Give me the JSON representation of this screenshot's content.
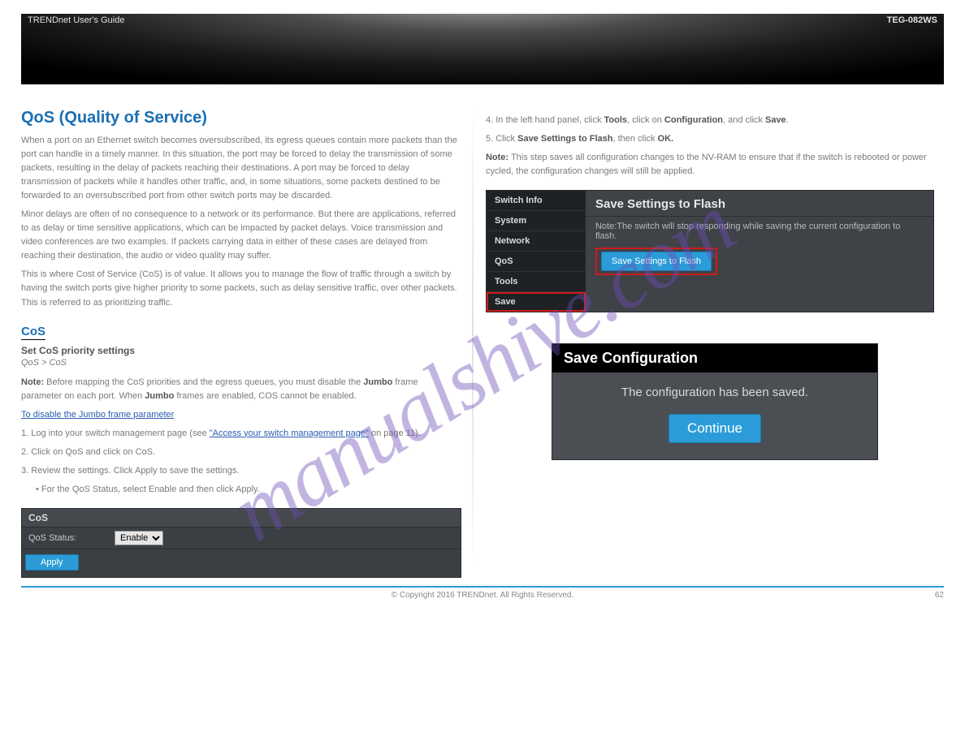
{
  "banner": {
    "left": "TRENDnet User's Guide",
    "right": "TEG-082WS"
  },
  "left": {
    "heading": "QoS (Quality of Service)",
    "intro1": "When a port on an Ethernet switch becomes oversubscribed, its egress queues contain more packets than the port can handle in a timely manner. In this situation, the port may be forced to delay the transmission of some packets, resulting in the delay of packets reaching their destinations. A port may be forced to delay transmission of packets while it handles other traffic, and, in some situations, some packets destined to be forwarded to an oversubscribed port from other switch ports may be discarded.",
    "intro2": "Minor delays are often of no consequence to a network or its performance. But there are applications, referred to as delay or time sensitive applications, which can be impacted by packet delays. Voice transmission and video conferences are two examples. If packets carrying data in either of these cases are delayed from reaching their destination, the audio or video quality may suffer.",
    "intro3": "This is where Cost of Service (CoS) is of value. It allows you to manage the flow of traffic through a switch by having the switch ports give higher priority to some packets, such as delay sensitive traffic, over other packets. This is referred to as prioritizing traffic.",
    "cos_heading": "CoS",
    "cos_heading_prefix_strong": "Set CoS priority settings",
    "cos_path": "QoS > CoS",
    "cos_note_label": "Note:",
    "cos_note1": " Before mapping the CoS priorities and the egress queues, you must disable the ",
    "cos_note_bold": "Jumbo",
    "cos_note2": " frame parameter on each port. When ",
    "cos_note3": " frames are enabled, COS cannot be enabled.",
    "jumbo_link_label": "Jumbo",
    "jumbo_link_text": "To disable the Jumbo frame parameter",
    "step1_prefix": "1. Log into your switch management page (see ",
    "step1_link": "\"Access your switch management page\"",
    "step1_suffix": " on page 11).",
    "step2": "2. Click on QoS and click on CoS.",
    "step3": "3. Review the settings. Click Apply to save the settings.",
    "cos_bullet_line": "For the QoS Status, select Enable and then click Apply.",
    "cos_panel": {
      "title": "CoS",
      "label": "QoS Status:",
      "option": "Enabled",
      "apply": "Apply"
    }
  },
  "right": {
    "step4_prefix": "4. In the left hand panel, click ",
    "step4_bold1": "Tools",
    "step4_mid1": ", click on ",
    "step4_bold2": "Configuration",
    "step4_mid2": ", and click ",
    "step4_bold3": "Save",
    "step4_end": ".",
    "step5_prefix": "5. Click ",
    "step5_bold1": "Save Settings to Flash",
    "step5_mid": ", then click ",
    "step5_bold2": "OK.",
    "step5_note_label": " Note:",
    "step5_note": " This step saves all configuration changes to the NV-RAM to ensure that if the switch is rebooted or power cycled, the configuration changes will still be applied.",
    "sf_panel": {
      "side_items": [
        "Switch Info",
        "System",
        "Network",
        "QoS",
        "Tools",
        "Save"
      ],
      "title": "Save Settings to Flash",
      "note": "Note:The switch will stop responding while saving the current configuration to flash.",
      "button": "Save Settings to Flash"
    },
    "sc_dialog": {
      "title": "Save Configuration",
      "msg": "The configuration has been saved.",
      "button": "Continue"
    }
  },
  "footer": {
    "copyright": "© Copyright 2016 TRENDnet. All Rights Reserved.",
    "page": "62"
  },
  "watermark": "manualshive.com"
}
